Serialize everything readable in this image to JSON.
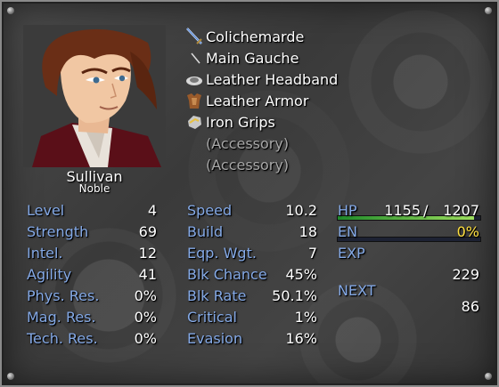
{
  "actor": {
    "name": "Sullivan",
    "class": "Noble"
  },
  "equipment": [
    {
      "label": "Colichemarde",
      "icon": "sword-icon",
      "empty": false
    },
    {
      "label": "Main Gauche",
      "icon": "dagger-icon",
      "empty": false
    },
    {
      "label": "Leather Headband",
      "icon": "headband-icon",
      "empty": false
    },
    {
      "label": "Leather Armor",
      "icon": "armor-icon",
      "empty": false
    },
    {
      "label": "Iron Grips",
      "icon": "gauntlet-icon",
      "empty": false
    },
    {
      "label": "(Accessory)",
      "icon": "",
      "empty": true
    },
    {
      "label": "(Accessory)",
      "icon": "",
      "empty": true
    }
  ],
  "stats_left": [
    {
      "label": "Level",
      "value": "4"
    },
    {
      "label": "Strength",
      "value": "69"
    },
    {
      "label": "Intel.",
      "value": "12"
    },
    {
      "label": "Agility",
      "value": "41"
    },
    {
      "label": "Phys. Res.",
      "value": "0%"
    },
    {
      "label": "Mag. Res.",
      "value": "0%"
    },
    {
      "label": "Tech. Res.",
      "value": "0%"
    }
  ],
  "stats_mid": [
    {
      "label": "Speed",
      "value": "10.2"
    },
    {
      "label": "Build",
      "value": "18"
    },
    {
      "label": "Eqp. Wgt.",
      "value": "7"
    },
    {
      "label": "Blk Chance",
      "value": "45%"
    },
    {
      "label": "Blk Rate",
      "value": "50.1%"
    },
    {
      "label": "Critical",
      "value": "1%"
    },
    {
      "label": "Evasion",
      "value": "16%"
    }
  ],
  "status": {
    "hp_label": "HP",
    "hp_current": "1155",
    "hp_sep": "/",
    "hp_max": "1207",
    "hp_ratio": 0.957,
    "en_label": "EN",
    "en_value": "0%",
    "en_ratio": 0.0,
    "exp_label": "EXP",
    "exp_value": "229",
    "next_label": "NEXT",
    "next_value": "86"
  },
  "colors": {
    "label_blue": "#84a9e6",
    "empty_gray": "#a8a8a8",
    "en_yellow": "#ffe040",
    "hp_gauge_start": "#1f8a2a",
    "hp_gauge_end": "#9ee060"
  }
}
